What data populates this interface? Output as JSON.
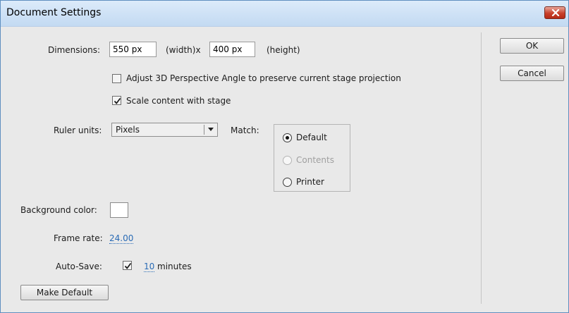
{
  "window": {
    "title": "Document Settings"
  },
  "dimensions": {
    "label": "Dimensions:",
    "width_value": "550 px",
    "width_suffix": "(width)x",
    "height_value": "400 px",
    "height_suffix": "(height)"
  },
  "options": {
    "adjust_3d_label": "Adjust 3D Perspective Angle to preserve current stage projection",
    "adjust_3d_checked": false,
    "scale_content_label": "Scale content with stage",
    "scale_content_checked": true
  },
  "ruler": {
    "label": "Ruler units:",
    "selected": "Pixels"
  },
  "match": {
    "label": "Match:",
    "options": [
      {
        "label": "Default",
        "selected": true,
        "disabled": false
      },
      {
        "label": "Contents",
        "selected": false,
        "disabled": true
      },
      {
        "label": "Printer",
        "selected": false,
        "disabled": false
      }
    ]
  },
  "background": {
    "label": "Background color:",
    "color": "#ffffff"
  },
  "frame_rate": {
    "label": "Frame rate:",
    "value": "24.00"
  },
  "autosave": {
    "label": "Auto-Save:",
    "checked": true,
    "value": "10",
    "unit": "minutes"
  },
  "buttons": {
    "make_default": "Make Default",
    "ok": "OK",
    "cancel": "Cancel"
  },
  "icons": {
    "close": "close-icon",
    "check": "check-icon",
    "dropdown": "chevron-down-icon"
  }
}
